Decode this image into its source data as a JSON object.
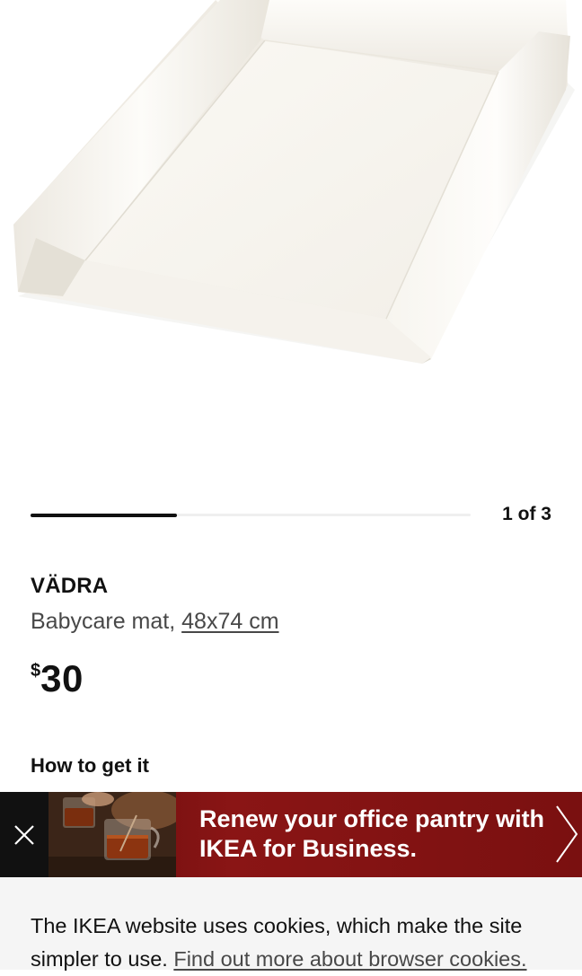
{
  "product": {
    "image_icon": "babycare-mat-product-photo",
    "name": "VÄDRA",
    "description": "Babycare mat,",
    "size": "48x74 cm",
    "currency": "$",
    "price": "30"
  },
  "carousel": {
    "counter": "1 of 3",
    "current": 1,
    "total": 3
  },
  "delivery": {
    "heading": "How to get it"
  },
  "promo": {
    "text": "Renew your office pantry with IKEA for Business.",
    "close_icon": "close-icon",
    "arrow_icon": "chevron-right-icon",
    "colors": {
      "background": "#7a1010",
      "close_background": "#111111",
      "text": "#ffffff"
    }
  },
  "cookie": {
    "text": "The IKEA website uses cookies, which make the site simpler to use.",
    "link": "Find out more about browser cookies."
  },
  "colors": {
    "text_primary": "#111111",
    "text_secondary": "#484848",
    "cookie_background": "#f5f5f5"
  }
}
